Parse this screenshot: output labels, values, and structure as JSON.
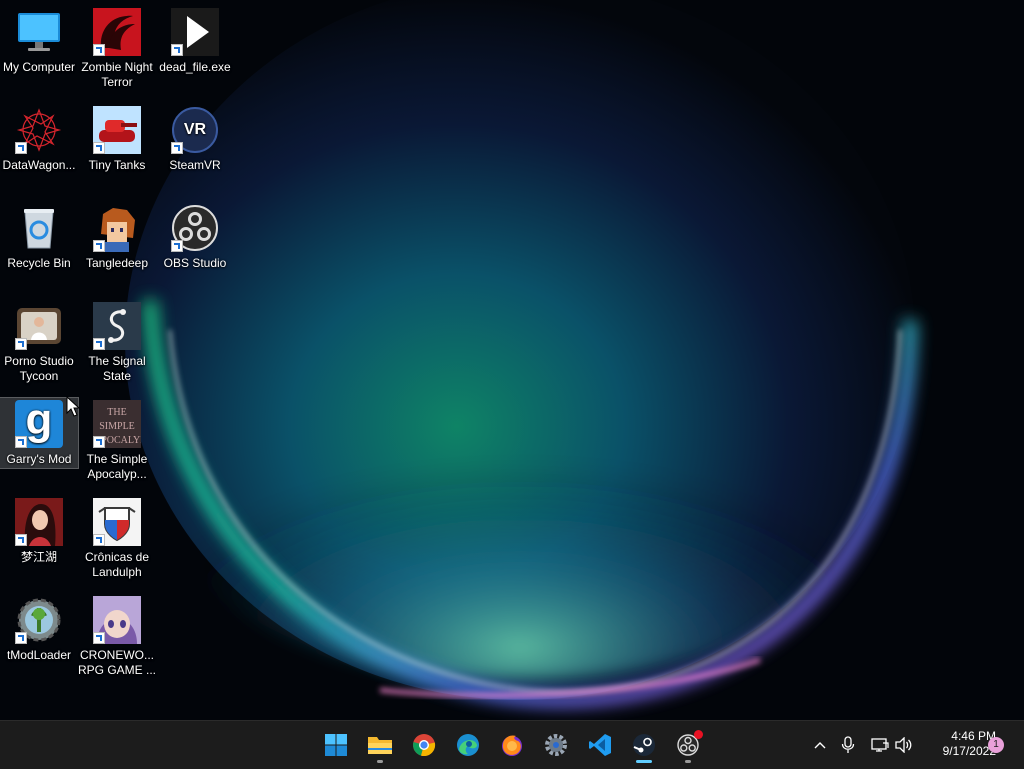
{
  "desktop": {
    "icons": [
      {
        "id": "my-computer",
        "label": "My Computer",
        "shortcut": false
      },
      {
        "id": "zombie-night-terror",
        "label": "Zombie Night Terror",
        "shortcut": true
      },
      {
        "id": "dead-file",
        "label": "dead_file.exe",
        "shortcut": true
      },
      {
        "id": "datawagon",
        "label": "DataWagon...",
        "shortcut": true
      },
      {
        "id": "tiny-tanks",
        "label": "Tiny Tanks",
        "shortcut": true
      },
      {
        "id": "steamvr",
        "label": "SteamVR",
        "shortcut": true
      },
      {
        "id": "recycle-bin",
        "label": "Recycle Bin",
        "shortcut": false
      },
      {
        "id": "tangledeep",
        "label": "Tangledeep",
        "shortcut": true
      },
      {
        "id": "obs-studio",
        "label": "OBS Studio",
        "shortcut": true
      },
      {
        "id": "porno-studio-tycoon",
        "label": "Porno Studio Tycoon",
        "shortcut": true
      },
      {
        "id": "the-signal-state",
        "label": "The Signal State",
        "shortcut": true
      },
      {
        "id": "garrys-mod",
        "label": "Garry's Mod",
        "shortcut": true,
        "selected": true
      },
      {
        "id": "the-simple-apocalypse",
        "label": "The Simple Apocalyp...",
        "shortcut": true,
        "thumb_text": "THE SIMPLE APOCALYPSE"
      },
      {
        "id": "mengjianghu",
        "label": "梦江湖",
        "shortcut": true
      },
      {
        "id": "cronicas-de-landulph",
        "label": "Crônicas de Landulph",
        "shortcut": true
      },
      {
        "id": "tmodloader",
        "label": "tModLoader",
        "shortcut": true
      },
      {
        "id": "cronewood",
        "label": "CRONEWO... RPG GAME ...",
        "shortcut": true
      }
    ],
    "steamvr_badge": "VR",
    "garrys_mod_glyph": "g"
  },
  "taskbar": {
    "apps": [
      {
        "name": "start-button",
        "icon": "windows-logo-icon",
        "running": false
      },
      {
        "name": "file-explorer-button",
        "icon": "folder-icon",
        "running": true
      },
      {
        "name": "chrome-button",
        "icon": "chrome-icon",
        "running": false
      },
      {
        "name": "edge-button",
        "icon": "edge-icon",
        "running": false
      },
      {
        "name": "firefox-button",
        "icon": "firefox-icon",
        "running": false
      },
      {
        "name": "settings-button",
        "icon": "gear-icon",
        "running": false
      },
      {
        "name": "vscode-button",
        "icon": "vscode-icon",
        "running": false
      },
      {
        "name": "steam-button",
        "icon": "steam-icon",
        "running": true,
        "active": true
      },
      {
        "name": "obs-button",
        "icon": "obs-icon",
        "running": true
      }
    ],
    "tray": {
      "chevron": "^",
      "time": "4:46 PM",
      "date": "9/17/2022",
      "notification_count": "1"
    }
  },
  "colors": {
    "taskbar_bg": "#1c1c1c",
    "accent": "#60cdff",
    "notification_badge": "#e9a0d9"
  }
}
